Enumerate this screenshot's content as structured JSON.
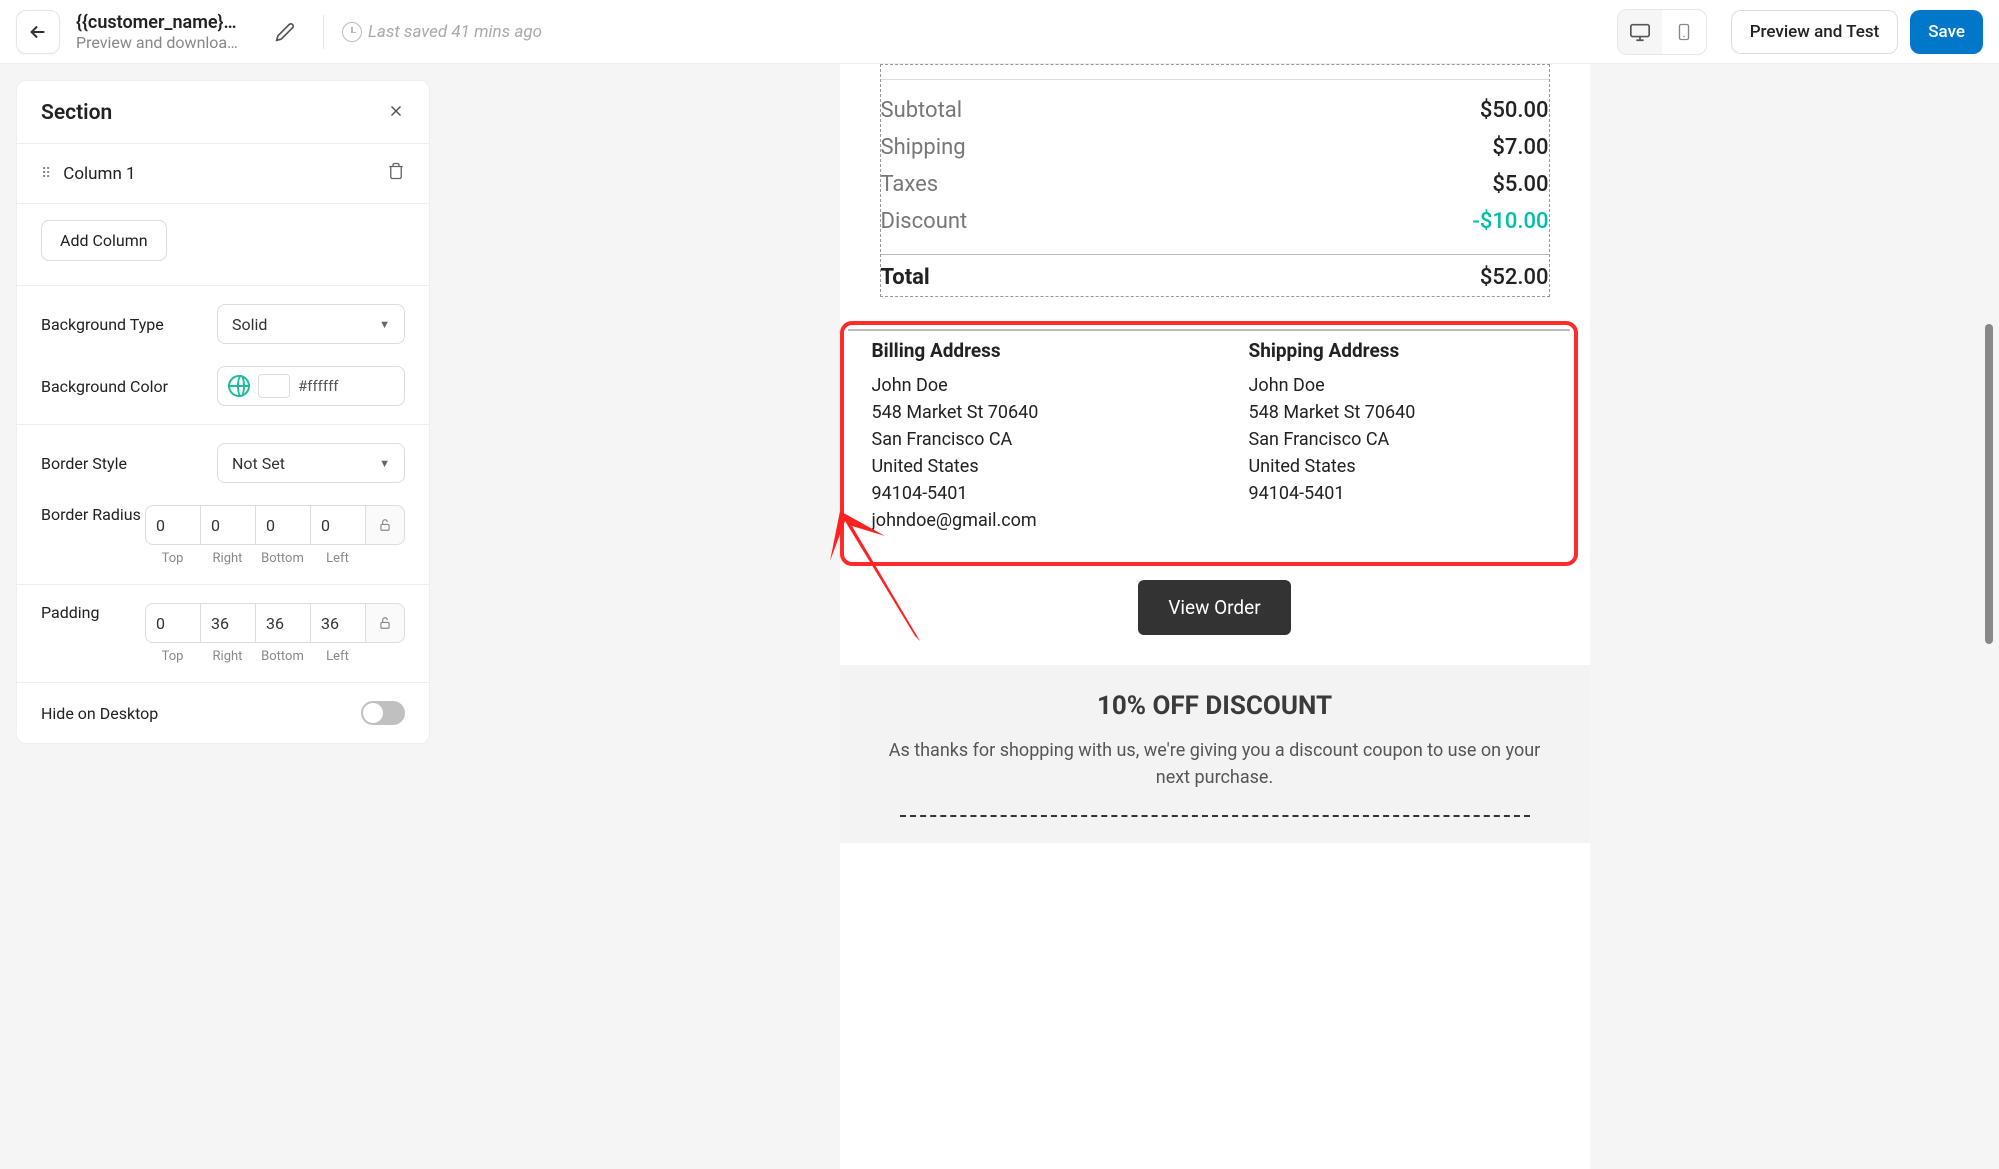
{
  "header": {
    "title": "{{customer_name}},...",
    "subtitle": "Preview and download...",
    "saved": "Last saved 41 mins ago",
    "preview_btn": "Preview and Test",
    "save_btn": "Save"
  },
  "panel": {
    "title": "Section",
    "column_label": "Column 1",
    "add_column": "Add Column",
    "bg_type_label": "Background Type",
    "bg_type_value": "Solid",
    "bg_color_label": "Background Color",
    "bg_color_value": "#ffffff",
    "border_style_label": "Border Style",
    "border_style_value": "Not Set",
    "border_radius_label": "Border Radius",
    "radius": {
      "top": "0",
      "right": "0",
      "bottom": "0",
      "left": "0"
    },
    "padding_label": "Padding",
    "padding": {
      "top": "0",
      "right": "36",
      "bottom": "36",
      "left": "36"
    },
    "sides": {
      "top": "Top",
      "right": "Right",
      "bottom": "Bottom",
      "left": "Left"
    },
    "hide_desktop_label": "Hide on Desktop"
  },
  "email": {
    "subtotal_lbl": "Subtotal",
    "subtotal_val": "$50.00",
    "shipping_lbl": "Shipping",
    "shipping_val": "$7.00",
    "taxes_lbl": "Taxes",
    "taxes_val": "$5.00",
    "discount_lbl": "Discount",
    "discount_val": "-$10.00",
    "total_lbl": "Total",
    "total_val": "$52.00",
    "billing_title": "Billing Address",
    "shipping_title": "Shipping Address",
    "addr_name": "John Doe",
    "addr_street": "548 Market St 70640",
    "addr_city": "San Francisco CA",
    "addr_country": "United States",
    "addr_zip": "94104-5401",
    "addr_email": "johndoe@gmail.com",
    "view_order": "View Order",
    "promo_title": "10% OFF DISCOUNT",
    "promo_text": "As thanks for shopping with us, we're giving you a discount coupon to use on your next purchase."
  }
}
